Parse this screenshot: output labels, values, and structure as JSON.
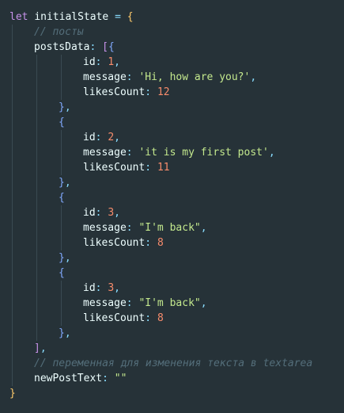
{
  "editor": {
    "background": "#263238",
    "lines": [
      {
        "indent": 0,
        "tokens": [
          {
            "t": "let",
            "c": "keyword"
          },
          {
            "t": " ",
            "c": "ident"
          },
          {
            "t": "initialState",
            "c": "ident"
          },
          {
            "t": " ",
            "c": "ident"
          },
          {
            "t": "=",
            "c": "op"
          },
          {
            "t": " ",
            "c": "ident"
          },
          {
            "t": "{",
            "c": "brace"
          }
        ]
      },
      {
        "indent": 1,
        "tokens": [
          {
            "t": "// посты",
            "c": "comment"
          }
        ]
      },
      {
        "indent": 1,
        "tokens": [
          {
            "t": "postsData",
            "c": "prop"
          },
          {
            "t": ": ",
            "c": "punct"
          },
          {
            "t": "[",
            "c": "bracket"
          },
          {
            "t": "{",
            "c": "brace2"
          }
        ]
      },
      {
        "indent": 3,
        "tokens": [
          {
            "t": "id",
            "c": "prop"
          },
          {
            "t": ": ",
            "c": "punct"
          },
          {
            "t": "1",
            "c": "number"
          },
          {
            "t": ",",
            "c": "punct"
          }
        ]
      },
      {
        "indent": 3,
        "tokens": [
          {
            "t": "message",
            "c": "prop"
          },
          {
            "t": ": ",
            "c": "punct"
          },
          {
            "t": "'Hi, how are you?'",
            "c": "string"
          },
          {
            "t": ",",
            "c": "punct"
          }
        ]
      },
      {
        "indent": 3,
        "tokens": [
          {
            "t": "likesCount",
            "c": "prop"
          },
          {
            "t": ": ",
            "c": "punct"
          },
          {
            "t": "12",
            "c": "number"
          }
        ]
      },
      {
        "indent": 2,
        "tokens": [
          {
            "t": "}",
            "c": "brace2"
          },
          {
            "t": ",",
            "c": "punct"
          }
        ]
      },
      {
        "indent": 2,
        "tokens": [
          {
            "t": "{",
            "c": "brace2"
          }
        ]
      },
      {
        "indent": 3,
        "tokens": [
          {
            "t": "id",
            "c": "prop"
          },
          {
            "t": ": ",
            "c": "punct"
          },
          {
            "t": "2",
            "c": "number"
          },
          {
            "t": ",",
            "c": "punct"
          }
        ]
      },
      {
        "indent": 3,
        "tokens": [
          {
            "t": "message",
            "c": "prop"
          },
          {
            "t": ": ",
            "c": "punct"
          },
          {
            "t": "'it is my first post'",
            "c": "string"
          },
          {
            "t": ",",
            "c": "punct"
          }
        ]
      },
      {
        "indent": 3,
        "tokens": [
          {
            "t": "likesCount",
            "c": "prop"
          },
          {
            "t": ": ",
            "c": "punct"
          },
          {
            "t": "11",
            "c": "number"
          }
        ]
      },
      {
        "indent": 2,
        "tokens": [
          {
            "t": "}",
            "c": "brace2"
          },
          {
            "t": ",",
            "c": "punct"
          }
        ]
      },
      {
        "indent": 2,
        "tokens": [
          {
            "t": "{",
            "c": "brace2"
          }
        ]
      },
      {
        "indent": 3,
        "tokens": [
          {
            "t": "id",
            "c": "prop"
          },
          {
            "t": ": ",
            "c": "punct"
          },
          {
            "t": "3",
            "c": "number"
          },
          {
            "t": ",",
            "c": "punct"
          }
        ]
      },
      {
        "indent": 3,
        "tokens": [
          {
            "t": "message",
            "c": "prop"
          },
          {
            "t": ": ",
            "c": "punct"
          },
          {
            "t": "\"I'm back\"",
            "c": "string"
          },
          {
            "t": ",",
            "c": "punct"
          }
        ]
      },
      {
        "indent": 3,
        "tokens": [
          {
            "t": "likesCount",
            "c": "prop"
          },
          {
            "t": ": ",
            "c": "punct"
          },
          {
            "t": "8",
            "c": "number"
          }
        ]
      },
      {
        "indent": 2,
        "tokens": [
          {
            "t": "}",
            "c": "brace2"
          },
          {
            "t": ",",
            "c": "punct"
          }
        ]
      },
      {
        "indent": 2,
        "tokens": [
          {
            "t": "{",
            "c": "brace2"
          }
        ]
      },
      {
        "indent": 3,
        "tokens": [
          {
            "t": "id",
            "c": "prop"
          },
          {
            "t": ": ",
            "c": "punct"
          },
          {
            "t": "3",
            "c": "number"
          },
          {
            "t": ",",
            "c": "punct"
          }
        ]
      },
      {
        "indent": 3,
        "tokens": [
          {
            "t": "message",
            "c": "prop"
          },
          {
            "t": ": ",
            "c": "punct"
          },
          {
            "t": "\"I'm back\"",
            "c": "string"
          },
          {
            "t": ",",
            "c": "punct"
          }
        ]
      },
      {
        "indent": 3,
        "tokens": [
          {
            "t": "likesCount",
            "c": "prop"
          },
          {
            "t": ": ",
            "c": "punct"
          },
          {
            "t": "8",
            "c": "number"
          }
        ]
      },
      {
        "indent": 2,
        "tokens": [
          {
            "t": "}",
            "c": "brace2"
          },
          {
            "t": ",",
            "c": "punct"
          }
        ]
      },
      {
        "indent": 1,
        "tokens": [
          {
            "t": "]",
            "c": "bracket"
          },
          {
            "t": ",",
            "c": "punct"
          }
        ]
      },
      {
        "indent": 1,
        "tokens": [
          {
            "t": "// переменная для изменения текста в textarea",
            "c": "comment"
          }
        ]
      },
      {
        "indent": 1,
        "tokens": [
          {
            "t": "newPostText",
            "c": "prop"
          },
          {
            "t": ": ",
            "c": "punct"
          },
          {
            "t": "\"\"",
            "c": "string"
          }
        ]
      },
      {
        "indent": 0,
        "tokens": [
          {
            "t": "}",
            "c": "brace"
          }
        ]
      }
    ]
  }
}
